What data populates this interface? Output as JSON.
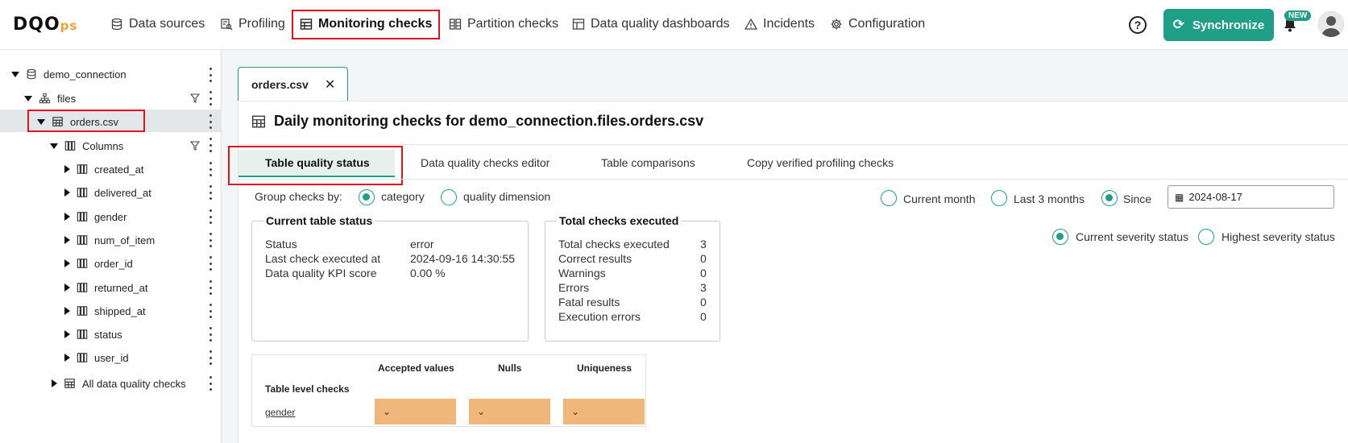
{
  "app": {
    "logo_main": "DQO",
    "logo_suffix": "ps"
  },
  "nav": {
    "items": [
      {
        "label": "Data sources",
        "icon": "database-icon"
      },
      {
        "label": "Profiling",
        "icon": "profiling-icon"
      },
      {
        "label": "Monitoring checks",
        "icon": "table-icon",
        "active": true
      },
      {
        "label": "Partition checks",
        "icon": "partition-icon"
      },
      {
        "label": "Data quality dashboards",
        "icon": "dashboard-icon"
      },
      {
        "label": "Incidents",
        "icon": "warning-icon"
      },
      {
        "label": "Configuration",
        "icon": "gear-icon"
      }
    ],
    "help_label": "?",
    "sync_label": "Synchronize",
    "new_badge": "NEW"
  },
  "tree": {
    "connection": "demo_connection",
    "schema": "files",
    "table": "orders.csv",
    "columns_label": "Columns",
    "columns": [
      "created_at",
      "delivered_at",
      "gender",
      "num_of_item",
      "order_id",
      "returned_at",
      "shipped_at",
      "status",
      "user_id"
    ],
    "all_checks_label": "All data quality checks"
  },
  "main": {
    "open_tab": "orders.csv",
    "close_glyph": "✕",
    "title": "Daily monitoring checks for demo_connection.files.orders.csv",
    "subtabs": [
      "Table quality status",
      "Data quality checks editor",
      "Table comparisons",
      "Copy verified profiling checks"
    ],
    "group_by_label": "Group checks by:",
    "group_options": [
      "category",
      "quality dimension"
    ],
    "period_options": [
      "Current month",
      "Last 3 months",
      "Since"
    ],
    "since_date": "2024-08-17",
    "severity_options": [
      "Current severity status",
      "Highest severity status"
    ]
  },
  "current_status": {
    "legend": "Current table status",
    "rows": [
      {
        "label": "Status",
        "value": "error"
      },
      {
        "label": "Last check executed at",
        "value": "2024-09-16 14:30:55"
      },
      {
        "label": "Data quality KPI score",
        "value": "0.00 %"
      }
    ]
  },
  "totals": {
    "legend": "Total checks executed",
    "rows": [
      {
        "label": "Total checks executed",
        "value": "3"
      },
      {
        "label": "Correct results",
        "value": "0"
      },
      {
        "label": "Warnings",
        "value": "0"
      },
      {
        "label": "Errors",
        "value": "3"
      },
      {
        "label": "Fatal results",
        "value": "0"
      },
      {
        "label": "Execution errors",
        "value": "0"
      }
    ]
  },
  "grid": {
    "headers": [
      "Accepted values",
      "Nulls",
      "Uniqueness"
    ],
    "section_label": "Table level checks",
    "row_label": "gender",
    "cell_glyph": "⌄",
    "error_color": "#f1b67a"
  },
  "colors": {
    "accent": "#1f9f86",
    "highlight": "#e0141e"
  }
}
